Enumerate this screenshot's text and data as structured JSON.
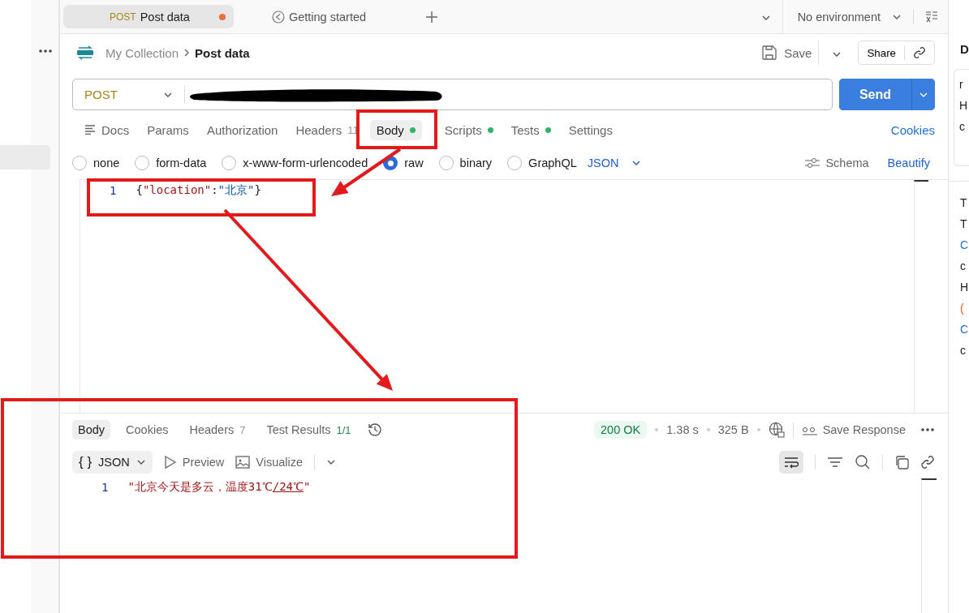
{
  "tabs": [
    {
      "kind": "request",
      "method": "POST",
      "title": "Post data",
      "unsaved": true,
      "selected": true
    },
    {
      "kind": "guide",
      "title": "Getting started",
      "selected": false
    }
  ],
  "environment": {
    "label": "No environment"
  },
  "breadcrumb": {
    "collection": "My Collection",
    "request": "Post data"
  },
  "actions": {
    "save": "Save",
    "share": "Share"
  },
  "request": {
    "method": "POST",
    "url_redacted": true,
    "send": "Send"
  },
  "request_tabs": [
    {
      "label": "Docs",
      "kind": "docs",
      "selected": false
    },
    {
      "label": "Params",
      "selected": false
    },
    {
      "label": "Authorization",
      "selected": false
    },
    {
      "label": "Headers",
      "count": "11",
      "selected": false
    },
    {
      "label": "Body",
      "dot": true,
      "selected": true
    },
    {
      "label": "Scripts",
      "dot": true,
      "selected": false
    },
    {
      "label": "Tests",
      "dot": true,
      "selected": false
    },
    {
      "label": "Settings",
      "selected": false
    }
  ],
  "cookies_link": "Cookies",
  "body_types": [
    {
      "label": "none",
      "selected": false
    },
    {
      "label": "form-data",
      "selected": false
    },
    {
      "label": "x-www-form-urlencoded",
      "selected": false
    },
    {
      "label": "raw",
      "selected": true
    },
    {
      "label": "binary",
      "selected": false
    },
    {
      "label": "GraphQL",
      "selected": false
    }
  ],
  "language": "JSON",
  "schema": "Schema",
  "beautify": "Beautify",
  "editor": {
    "lines": [
      {
        "number": "1",
        "tokens": [
          {
            "kind": "punct",
            "text": "{"
          },
          {
            "kind": "key",
            "text": "\"location\""
          },
          {
            "kind": "punct",
            "text": ":"
          },
          {
            "kind": "string",
            "text": "\"北京\""
          },
          {
            "kind": "punct",
            "text": "}"
          }
        ]
      }
    ]
  },
  "response": {
    "tabs": [
      {
        "label": "Body",
        "selected": true
      },
      {
        "label": "Cookies",
        "selected": false
      },
      {
        "label": "Headers",
        "count": "7",
        "selected": false
      },
      {
        "label": "Test Results",
        "count": "1/1",
        "selected": false
      }
    ],
    "status": "200 OK",
    "time": "1.38 s",
    "size": "325 B",
    "save_response": "Save Response",
    "format_icon": "{ }",
    "format": "JSON",
    "preview": "Preview",
    "visualize": "Visualize",
    "wrap_on": true,
    "lines": [
      {
        "number": "1",
        "tokens": [
          {
            "kind": "rstring",
            "text": "\"北京今天是多云，温度31℃"
          },
          {
            "kind": "link",
            "text": "/24℃"
          },
          {
            "kind": "rstring",
            "text": "\""
          }
        ]
      }
    ]
  },
  "right_panel": {
    "heading": "D",
    "fragments": [
      {
        "text": "r"
      },
      {
        "text": "H"
      },
      {
        "text": "c"
      },
      {
        "text": "T"
      },
      {
        "text": "T"
      },
      {
        "text": "C",
        "kind": "link"
      },
      {
        "text": "c"
      },
      {
        "text": "H"
      },
      {
        "text": "(",
        "kind": "warn"
      },
      {
        "text": "C",
        "kind": "link"
      },
      {
        "text": "c"
      }
    ]
  },
  "annotations": [
    {
      "kind": "box"
    },
    {
      "kind": "box"
    },
    {
      "kind": "box"
    },
    {
      "kind": "arrow"
    },
    {
      "kind": "arrow"
    }
  ]
}
